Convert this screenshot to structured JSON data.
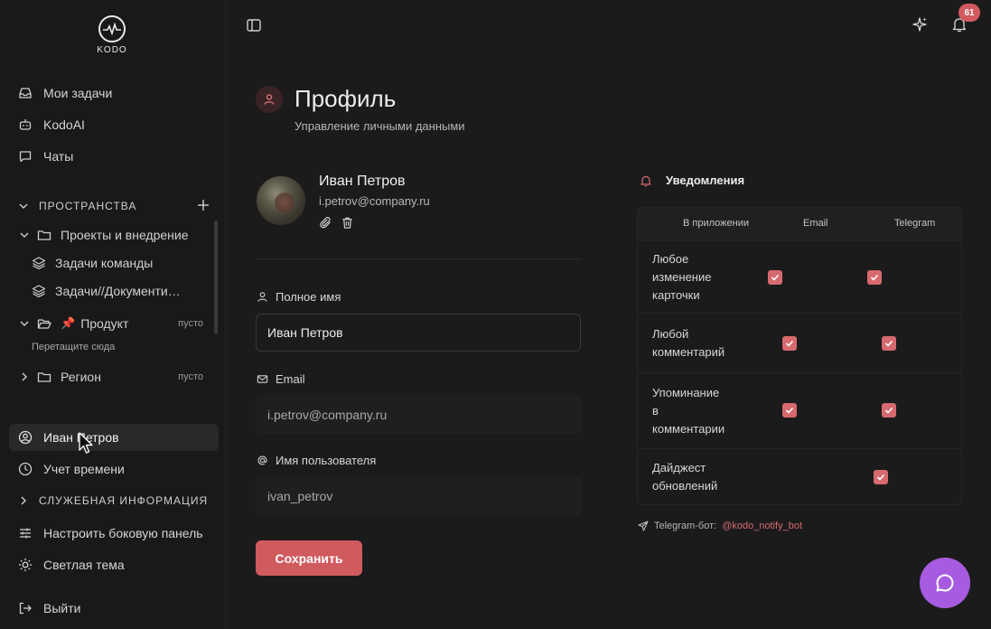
{
  "brand": {
    "name": "KODO"
  },
  "sidebar": {
    "nav": [
      {
        "label": "Мои задачи",
        "icon": "inbox-icon"
      },
      {
        "label": "KodoAI",
        "icon": "bot-icon"
      },
      {
        "label": "Чаты",
        "icon": "chat-icon"
      }
    ],
    "spaces_title": "ПРОСТРАНСТВА",
    "tree": [
      {
        "label": "Проекты и внедрение",
        "icon": "folder-icon"
      },
      {
        "label": "Задачи команды",
        "icon": "layers-icon"
      },
      {
        "label": "Задачи//Документи…",
        "icon": "layers-icon"
      },
      {
        "label": "Продукт",
        "icon": "folder-icon",
        "pin": "📌",
        "tag": "пусто"
      },
      {
        "label": "Регион",
        "icon": "folder-icon",
        "tag": "пусто"
      }
    ],
    "drop_hint": "Перетащите сюда",
    "profile_item": "Иван Петров",
    "time_item": "Учет времени",
    "service_title": "СЛУЖЕБНАЯ ИНФОРМАЦИЯ",
    "customize_item": "Настроить боковую панель",
    "theme_item": "Светлая тема",
    "logout_item": "Выйти"
  },
  "topbar": {
    "notif_count": "61"
  },
  "page": {
    "title": "Профиль",
    "subtitle": "Управление личными данными"
  },
  "user": {
    "name": "Иван Петров",
    "email": "i.petrov@company.ru"
  },
  "form": {
    "fullname_label": "Полное имя",
    "fullname_value": "Иван Петров",
    "email_label": "Email",
    "email_value": "i.petrov@company.ru",
    "username_label": "Имя пользователя",
    "username_value": "ivan_petrov",
    "save_label": "Сохранить"
  },
  "notifications": {
    "title": "Уведомления",
    "columns": [
      "В приложении",
      "Email",
      "Telegram"
    ],
    "rows": [
      {
        "label": "Любое изменение карточки",
        "lines": [
          "Любое",
          "изменение",
          "карточки"
        ],
        "app": true,
        "email": true,
        "telegram": false
      },
      {
        "label": "Любой комментарий",
        "lines": [
          "Любой",
          "комментарий"
        ],
        "app": false,
        "email": true,
        "telegram": true
      },
      {
        "label": "Упоминание в комментарии",
        "lines": [
          "Упоминание",
          "в",
          "комментарии"
        ],
        "app": false,
        "email": true,
        "telegram": true
      },
      {
        "label": "Дайджест обновлений",
        "lines": [
          "Дайджест",
          "обновлений"
        ],
        "app": false,
        "email": false,
        "telegram": true
      }
    ],
    "bot_label": "Telegram-бот:",
    "bot_handle": "@kodo_notify_bot"
  },
  "colors": {
    "accent": "#d15a5e",
    "fab": "#a65be0",
    "badge": "#d25a5f"
  }
}
